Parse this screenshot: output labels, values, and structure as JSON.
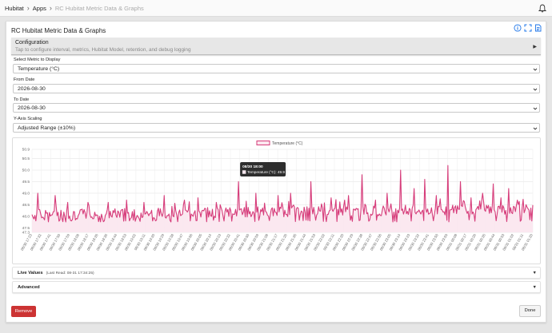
{
  "breadcrumb": {
    "home": "Hubitat",
    "apps": "Apps",
    "current": "RC Hubitat Metric Data & Graphs"
  },
  "app": {
    "title": "RC Hubitat Metric Data & Graphs",
    "configuration": {
      "title": "Configuration",
      "subtitle": "Tap to configure interval, metrics, Hubitat Model, retention, and debug logging"
    }
  },
  "fields": {
    "metric": {
      "label": "Select Metric to Display",
      "value": "Temperature (°C)"
    },
    "from": {
      "label": "From Date",
      "value": "2026-08-30"
    },
    "to": {
      "label": "To Date",
      "value": "2026-08-30"
    },
    "scaling": {
      "label": "Y-Axis Scaling",
      "value": "Adjusted Range (±10%)"
    }
  },
  "chart_data": {
    "type": "area",
    "series": [
      {
        "name": "Temperature (°C)",
        "color": "#d63c7a"
      }
    ],
    "ylim": [
      47.3,
      50.9
    ],
    "y_ticks": [
      "50.9",
      "50.5",
      "50.0",
      "49.5",
      "49.0",
      "48.5",
      "48.0",
      "47.5",
      "47.3"
    ],
    "x_tick_labels": [
      "08/30 17:23",
      "08/30 17:32",
      "08/30 17:41",
      "08/30 17:50",
      "08/30 17:59",
      "08/30 18:08",
      "08/30 18:17",
      "08/30 18:26",
      "08/30 18:35",
      "08/30 18:44",
      "08/30 18:53",
      "08/30 19:02",
      "08/30 19:11",
      "08/30 19:20",
      "08/30 19:29",
      "08/30 19:38",
      "08/30 19:47",
      "08/30 19:56",
      "08/30 20:05",
      "08/30 20:14",
      "08/30 20:23",
      "08/30 20:32",
      "08/30 20:41",
      "08/30 20:50",
      "08/30 20:59",
      "08/30 21:08",
      "08/30 21:17",
      "08/30 21:26",
      "08/30 21:35",
      "08/30 21:44",
      "08/30 21:53",
      "08/30 22:02",
      "08/30 22:11",
      "08/30 22:20",
      "08/30 22:29",
      "08/30 22:38",
      "08/30 22:47",
      "08/30 22:56",
      "08/30 23:05",
      "08/30 23:14",
      "08/30 23:23",
      "08/30 23:32",
      "08/30 23:41",
      "08/30 23:50",
      "08/30 23:59",
      "08/31 00:08",
      "08/31 00:17",
      "08/31 00:26",
      "08/31 00:35",
      "08/31 00:44",
      "08/31 00:53",
      "08/31 01:02",
      "08/31 01:11",
      "08/31 01:20"
    ],
    "point_count": 520,
    "baseline_range": [
      47.8,
      48.4
    ],
    "spikes": [
      {
        "index": 6,
        "value": 49.0
      },
      {
        "index": 24,
        "value": 48.9
      },
      {
        "index": 37,
        "value": 48.6
      },
      {
        "index": 58,
        "value": 48.6
      },
      {
        "index": 79,
        "value": 48.6
      },
      {
        "index": 98,
        "value": 48.7
      },
      {
        "index": 116,
        "value": 48.6
      },
      {
        "index": 137,
        "value": 48.9
      },
      {
        "index": 158,
        "value": 48.7
      },
      {
        "index": 172,
        "value": 48.8
      },
      {
        "index": 191,
        "value": 48.6
      },
      {
        "index": 214,
        "value": 49.5
      },
      {
        "index": 232,
        "value": 49.0
      },
      {
        "index": 255,
        "value": 48.9
      },
      {
        "index": 268,
        "value": 49.0
      },
      {
        "index": 289,
        "value": 49.5
      },
      {
        "index": 310,
        "value": 48.8
      },
      {
        "index": 328,
        "value": 48.9
      },
      {
        "index": 342,
        "value": 49.8
      },
      {
        "index": 356,
        "value": 48.7
      },
      {
        "index": 368,
        "value": 49.0
      },
      {
        "index": 382,
        "value": 50.0
      },
      {
        "index": 396,
        "value": 49.2
      },
      {
        "index": 407,
        "value": 49.6
      },
      {
        "index": 419,
        "value": 48.9
      },
      {
        "index": 431,
        "value": 50.2
      },
      {
        "index": 444,
        "value": 49.5
      },
      {
        "index": 455,
        "value": 48.8
      },
      {
        "index": 467,
        "value": 49.0
      },
      {
        "index": 478,
        "value": 49.4
      },
      {
        "index": 486,
        "value": 48.8
      },
      {
        "index": 494,
        "value": 49.2
      },
      {
        "index": 503,
        "value": 48.7
      },
      {
        "index": 512,
        "value": 48.5
      }
    ],
    "tooltip": {
      "title": "08/30 18:00",
      "label": "Temperature (°C): 49.9",
      "index": 214
    }
  },
  "accordions": {
    "live": {
      "title": "Live Values",
      "subtitle": "(Last Read: 08-31 17:34:25)"
    },
    "advanced": {
      "title": "Advanced"
    }
  },
  "buttons": {
    "remove": "Remove",
    "done": "Done"
  },
  "icons": {
    "bell": "bell-icon",
    "info": "info-icon",
    "expand": "fullscreen-icon",
    "doc": "app-doc-icon",
    "chevron": "chevron-down-icon"
  },
  "colors": {
    "accent": "#d63c7a",
    "fill": "#fbe6ee",
    "info": "#1a73e8",
    "remove": "#cc3333"
  }
}
